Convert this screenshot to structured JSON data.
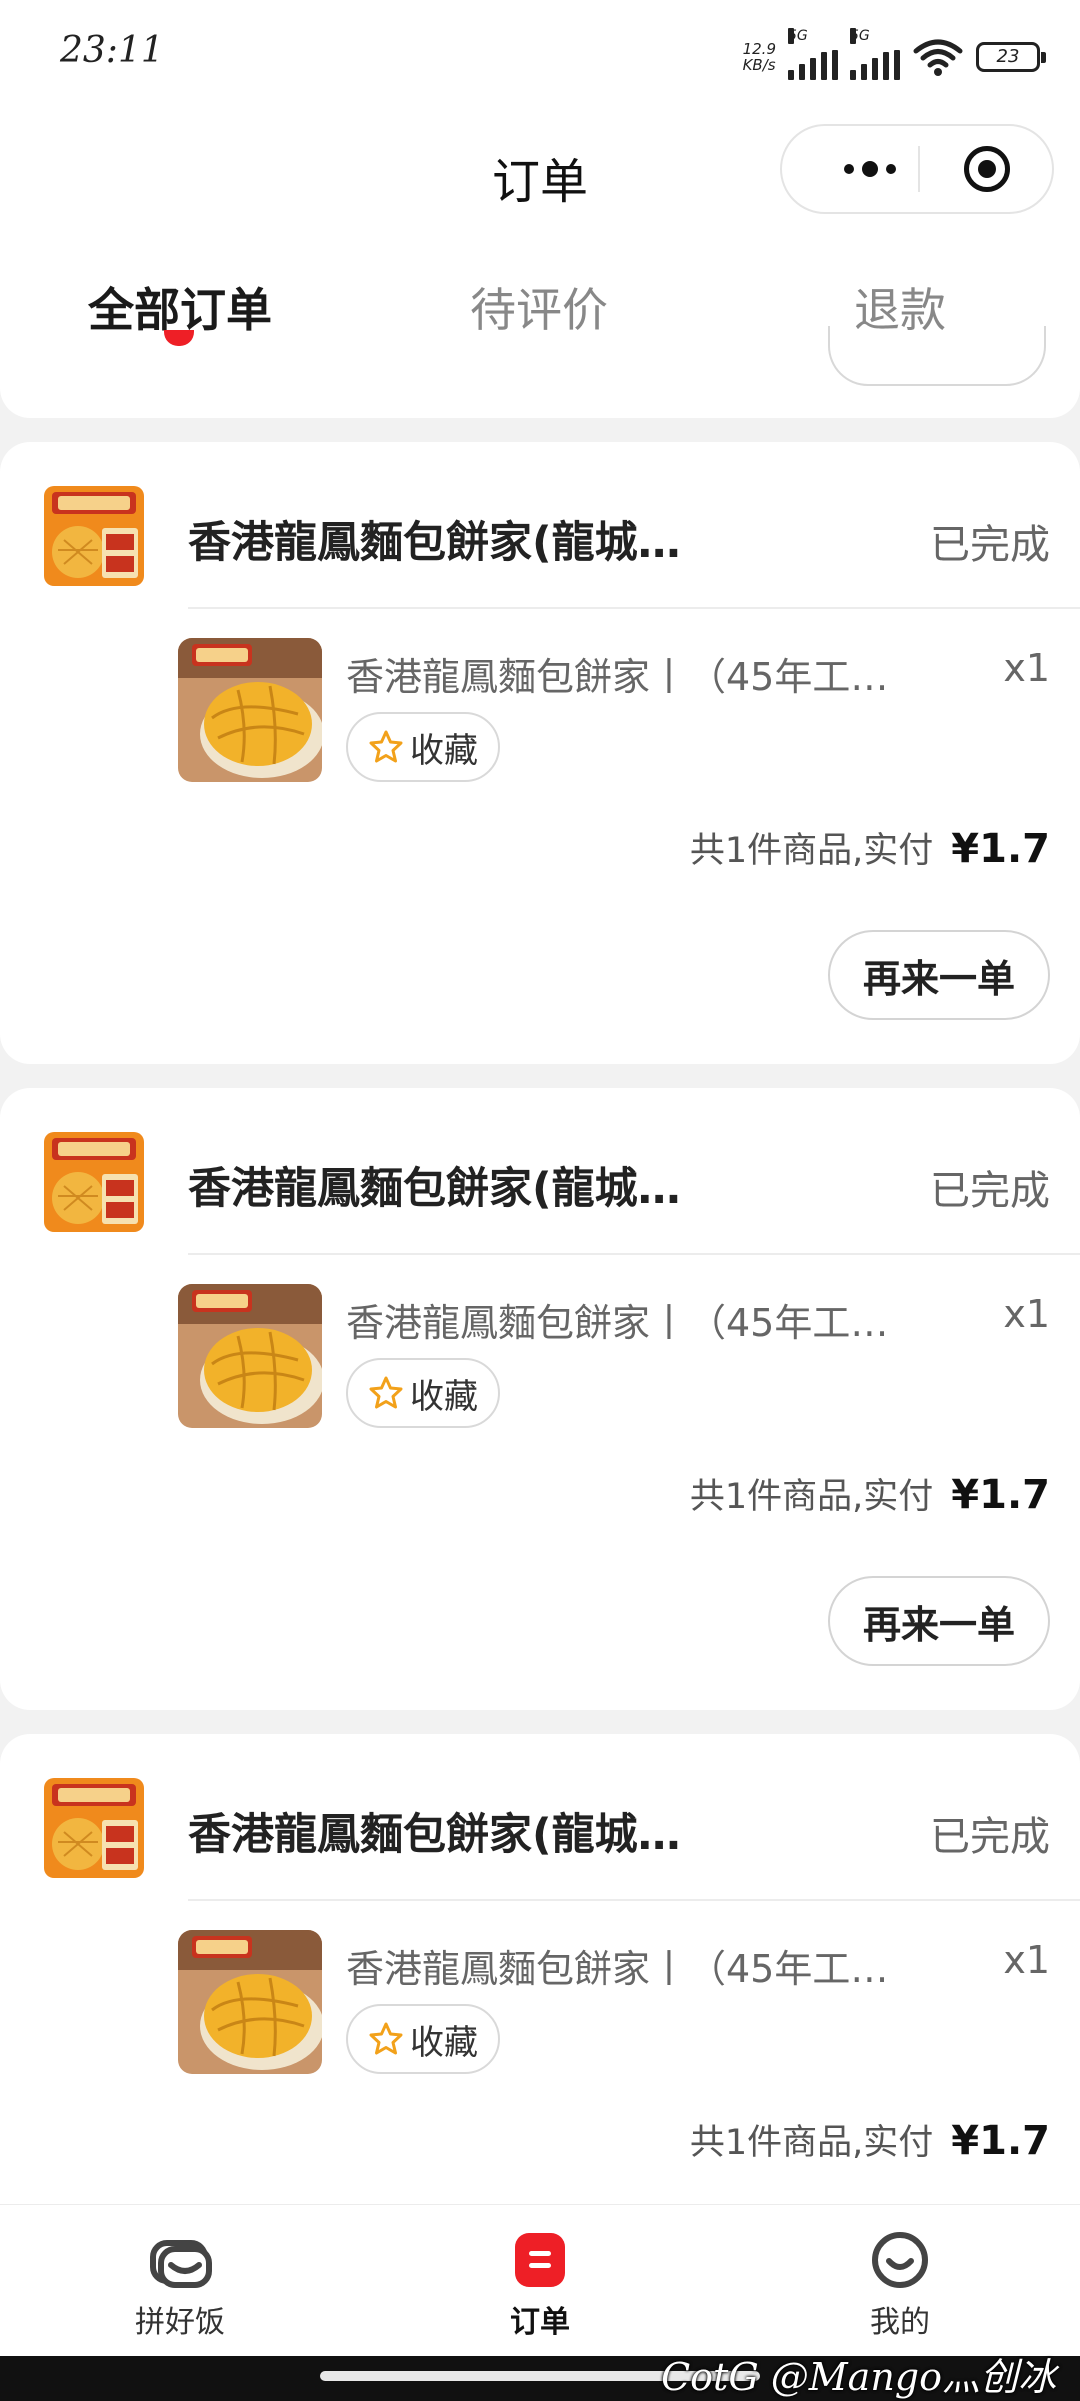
{
  "status_bar": {
    "time": "23:11",
    "net_speed_top": "12.9",
    "net_speed_bottom": "KB/s",
    "sim1_label": "5G",
    "sim2_label": "5G",
    "battery": "23"
  },
  "header": {
    "title": "订单"
  },
  "tabs": [
    {
      "label": "全部订单",
      "active": true
    },
    {
      "label": "待评价",
      "active": false
    },
    {
      "label": "退款",
      "active": false
    }
  ],
  "orders": [
    {
      "store_name": "香港龍鳳麵包餅家(龍城…",
      "status": "已完成",
      "item_name": "香港龍鳳麵包餅家丨（45年工…",
      "quantity": "x1",
      "favorite_label": "收藏",
      "total_text": "共1件商品,实付",
      "total_price": "¥1.7",
      "reorder_label": "再来一单"
    },
    {
      "store_name": "香港龍鳳麵包餅家(龍城…",
      "status": "已完成",
      "item_name": "香港龍鳳麵包餅家丨（45年工…",
      "quantity": "x1",
      "favorite_label": "收藏",
      "total_text": "共1件商品,实付",
      "total_price": "¥1.7",
      "reorder_label": "再来一单"
    },
    {
      "store_name": "香港龍鳳麵包餅家(龍城…",
      "status": "已完成",
      "item_name": "香港龍鳳麵包餅家丨（45年工…",
      "quantity": "x1",
      "favorite_label": "收藏",
      "total_text": "共1件商品,实付",
      "total_price": "¥1.7"
    }
  ],
  "bottom_nav": [
    {
      "label": "拼好饭",
      "icon": "bowl-icon",
      "active": false
    },
    {
      "label": "订单",
      "icon": "order-icon",
      "active": true
    },
    {
      "label": "我的",
      "icon": "smile-icon",
      "active": false
    }
  ],
  "watermark": "CotG @Mango灬创冰",
  "colors": {
    "accent": "#ee1f26",
    "logo_orange": "#f08a1c",
    "star": "#f2a11a"
  }
}
